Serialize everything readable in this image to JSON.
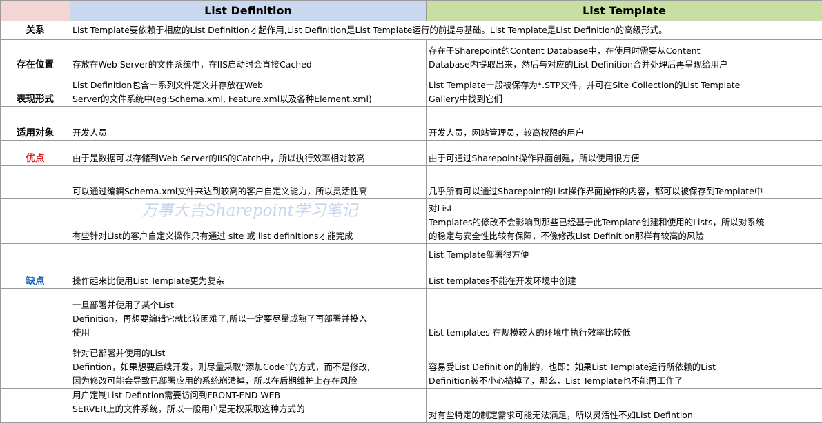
{
  "header": {
    "corner": "",
    "definition": "List  Definition",
    "template": "List Template"
  },
  "watermark": "万事大吉Sharepoint学习笔记",
  "rows": [
    {
      "label": "关系",
      "merged_text": "List Template要依赖于相应的List Definition才起作用,List Definition是List Template运行的前提与基础。List Template是List Definition的高级形式。"
    },
    {
      "label": "存在位置",
      "definition": "存放在Web Server的文件系统中，在IIS启动时会直接Cached",
      "template": [
        "存在于Sharepoint的Content Database中，在使用时需要从Content",
        "Database内提取出来，然后与对应的List Definition合并处理后再呈现给用户"
      ]
    },
    {
      "label": "表现形式",
      "definition": [
        "List Definition包含一系列文件定义并存放在Web",
        "Server的文件系统中(eg:Schema.xml, Feature.xml以及各种Element.xml)"
      ],
      "template": [
        "List Template一般被保存为*.STP文件，并可在Site Collection的List Template",
        "Gallery中找到它们"
      ]
    },
    {
      "label": "适用对象",
      "definition": "开发人员",
      "template": "开发人员，网站管理员，较高权限的用户"
    },
    {
      "label": "优点",
      "definition": "由于是数据可以存储到Web Server的IIS的Catch中，所以执行效率相对较高",
      "template": "由于可通过Sharepoint操作界面创建，所以使用很方便"
    },
    {
      "label": "",
      "definition": "可以通过编辑Schema.xml文件来达到较高的客户自定义能力，所以灵活性高",
      "template": "几乎所有可以通过Sharepoint的List操作界面操作的内容，都可以被保存到Template中"
    },
    {
      "label": "",
      "definition": "有些针对List的客户自定义操作只有通过 site 或 list definitions才能完成",
      "template": [
        "对List",
        "Templates的修改不会影响到那些已经基于此Template创建和使用的Lists，所以对系统",
        "的稳定与安全性比较有保障，不像修改List Definition那样有较高的风险"
      ]
    },
    {
      "label": "",
      "definition": "",
      "template": "List Template部署很方便"
    },
    {
      "label": "缺点",
      "definition": "操作起来比使用List Template更为复杂",
      "template": "List templates不能在开发环境中创建"
    },
    {
      "label": "",
      "definition": [
        "一旦部署并使用了某个List",
        "Definition，再想要编辑它就比较困难了,所以一定要尽量成熟了再部署并投入",
        "使用"
      ],
      "template": "List templates 在规模较大的环境中执行效率比较低"
    },
    {
      "label": "",
      "definition": [
        "针对已部署并使用的List",
        "Defintion，如果想要后续开发，则尽量采取“添加Code”的方式，而不是修改,",
        "因为修改可能会导致已部署应用的系统崩溃掉，所以在后期维护上存在风险"
      ],
      "template": [
        "容易受List Definition的制约，也即：如果List Template运行所依赖的List",
        "Definition被不小心搞掉了，那么，List Template也不能再工作了"
      ]
    },
    {
      "label": "",
      "definition": [
        "用户定制List Defintion需要访问到FRONT-END WEB",
        "SERVER上的文件系统，所以一般用户是无权采取这种方式的"
      ],
      "template": "对有些特定的制定需求可能无法满足，所以灵活性不如List Defintion"
    }
  ]
}
